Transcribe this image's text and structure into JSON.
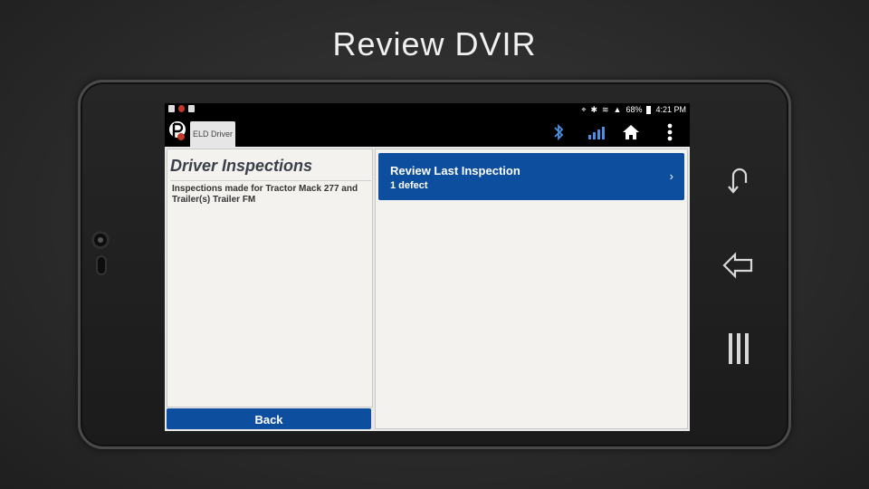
{
  "slide": {
    "title": "Review DVIR"
  },
  "status_bar": {
    "battery": "68%",
    "time": "4:21 PM"
  },
  "action_bar": {
    "driver_tab": "ELD Driver",
    "icons": [
      "bluetooth-icon",
      "signal-icon",
      "home-icon",
      "more-icon"
    ]
  },
  "left_panel": {
    "title": "Driver Inspections",
    "description": "Inspections made for Tractor Mack 277 and Trailer(s) Trailer FM",
    "back_label": "Back"
  },
  "right_panel": {
    "review": {
      "title": "Review Last Inspection",
      "subtitle": "1 defect",
      "chevron": "›"
    }
  },
  "colors": {
    "accent": "#0d4f9e",
    "panel_bg": "#f4f2ef",
    "bar_bg": "#000000"
  }
}
